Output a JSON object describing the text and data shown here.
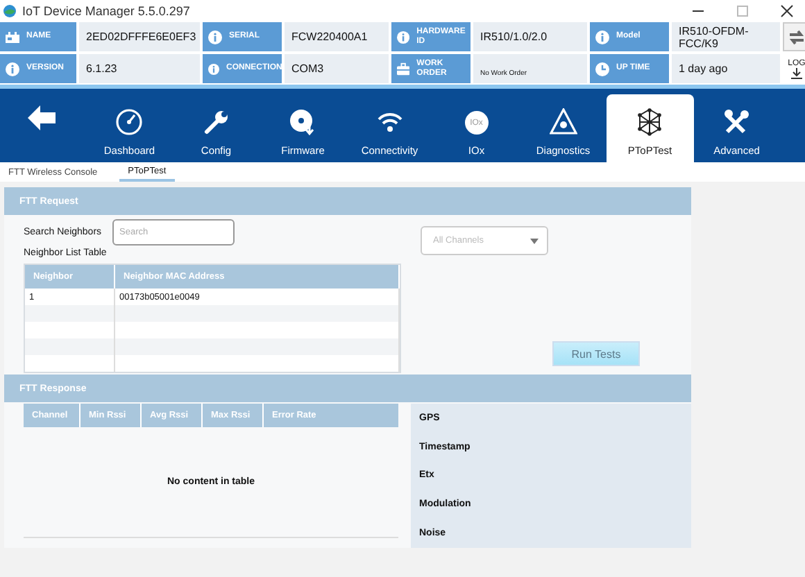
{
  "window": {
    "title": "IoT Device Manager 5.5.0.297"
  },
  "info_fields": [
    {
      "label": "NAME",
      "value": "2ED02DFFFE6E0EF3"
    },
    {
      "label": "SERIAL",
      "value": "FCW220400A1"
    },
    {
      "label": "HARDWARE ID",
      "value": "IR510/1.0/2.0"
    },
    {
      "label": "Model",
      "value": "IR510-OFDM-FCC/K9"
    },
    {
      "label": "VERSION",
      "value": "6.1.23"
    },
    {
      "label": "CONNECTION",
      "value": "COM3"
    },
    {
      "label": "WORK ORDER",
      "value": "No Work Order"
    },
    {
      "label": "UP TIME",
      "value": "1 day ago"
    }
  ],
  "log_button": {
    "label": "LOG"
  },
  "nav": [
    {
      "label": "Dashboard",
      "selected": false
    },
    {
      "label": "Config",
      "selected": false
    },
    {
      "label": "Firmware",
      "selected": false
    },
    {
      "label": "Connectivity",
      "selected": false
    },
    {
      "label": "IOx",
      "selected": false
    },
    {
      "label": "Diagnostics",
      "selected": false
    },
    {
      "label": "PToPTest",
      "selected": true
    },
    {
      "label": "Advanced",
      "selected": false
    }
  ],
  "iox_badge": "IOx",
  "subtabs": [
    {
      "label": "FTT Wireless Console",
      "selected": false
    },
    {
      "label": "PToPTest",
      "selected": true
    }
  ],
  "request": {
    "title": "FTT Request",
    "search_label": "Search Neighbors",
    "search": {
      "placeholder": "Search"
    },
    "list_label": "Neighbor List Table",
    "columns": [
      "Neighbor",
      "Neighbor MAC Address"
    ],
    "rows": [
      [
        "1",
        "00173b05001e0049"
      ]
    ],
    "channel_select": {
      "placeholder": "All Channels"
    },
    "run_button": {
      "label": "Run Tests"
    }
  },
  "response": {
    "title": "FTT Response",
    "columns": [
      "Channel",
      "Min Rssi",
      "Avg Rssi",
      "Max Rssi",
      "Error Rate"
    ],
    "empty_message": "No content in table",
    "details": [
      "GPS",
      "Timestamp",
      "Etx",
      "Modulation",
      "Noise"
    ]
  }
}
